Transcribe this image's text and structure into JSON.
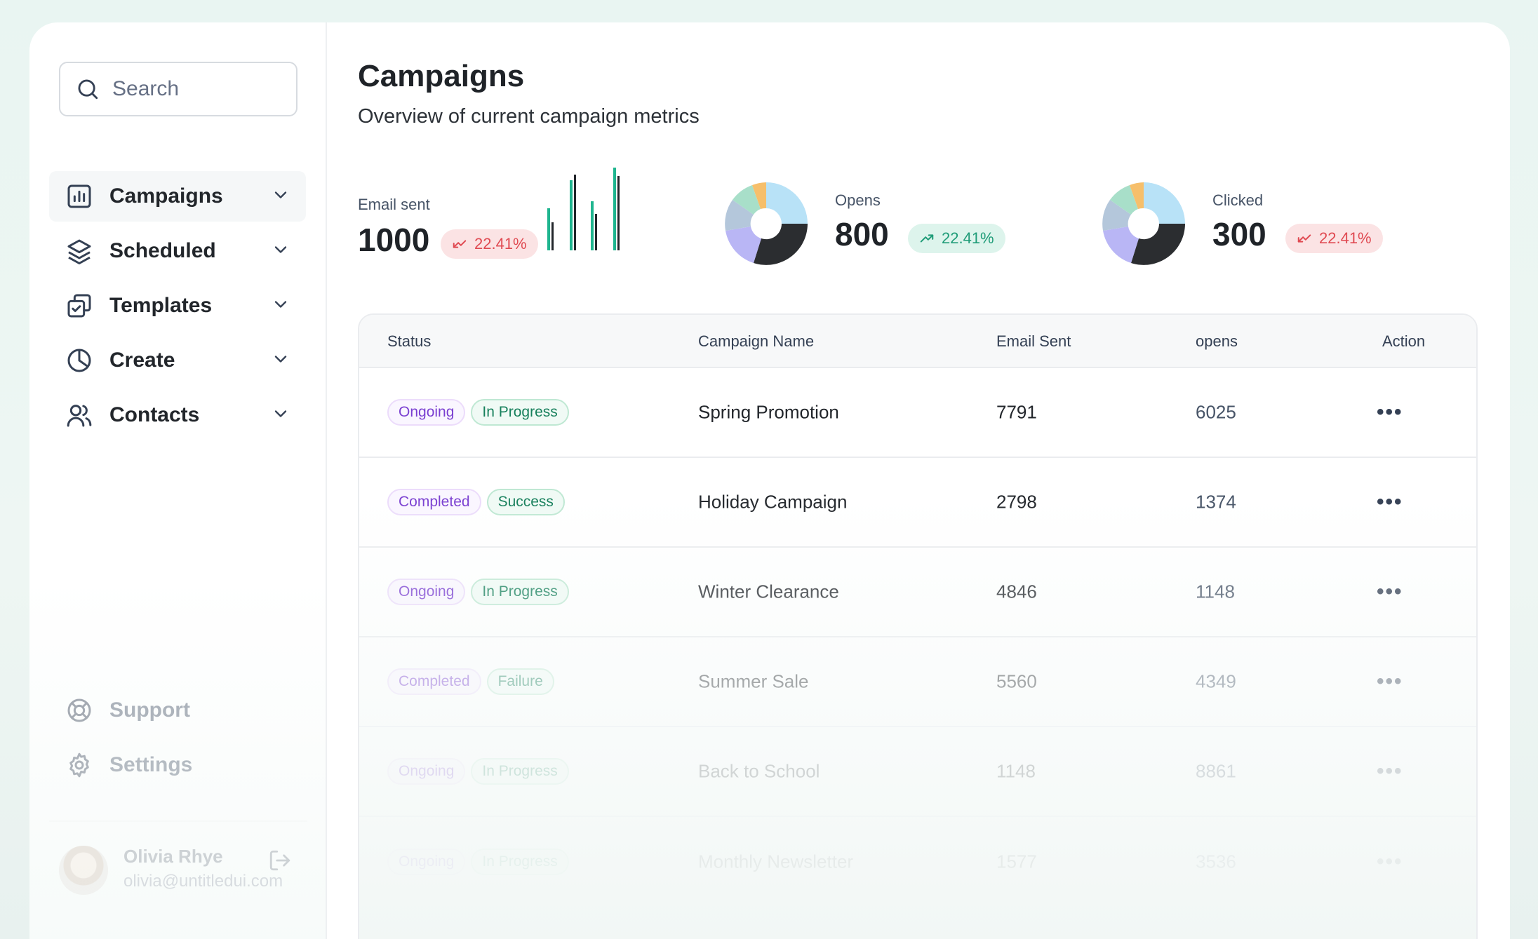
{
  "search": {
    "placeholder": "Search"
  },
  "sidebar": {
    "items": [
      {
        "label": "Campaigns",
        "icon": "bar-chart-icon",
        "active": true
      },
      {
        "label": "Scheduled",
        "icon": "layers-icon"
      },
      {
        "label": "Templates",
        "icon": "copy-check-icon"
      },
      {
        "label": "Create",
        "icon": "pie-chart-icon"
      },
      {
        "label": "Contacts",
        "icon": "users-icon"
      }
    ],
    "bottom": [
      {
        "label": "Support",
        "icon": "life-buoy-icon"
      },
      {
        "label": "Settings",
        "icon": "gear-icon"
      }
    ]
  },
  "user": {
    "name": "Olivia Rhye",
    "email": "olivia@untitledui.com"
  },
  "header": {
    "title": "Campaigns",
    "subtitle": "Overview of current campaign metrics"
  },
  "metrics": {
    "email_sent": {
      "label": "Email sent",
      "value": "1000",
      "change": "22.41%",
      "trend": "down"
    },
    "opens": {
      "label": "Opens",
      "value": "800",
      "change": "22.41%",
      "trend": "up"
    },
    "clicked": {
      "label": "Clicked",
      "value": "300",
      "change": "22.41%",
      "trend": "down"
    }
  },
  "colors": {
    "accent_teal": "#1fb58f",
    "down": "#e04a52",
    "up": "#1f9c78",
    "donut": [
      "#2b2d30",
      "#b9b6f5",
      "#b4c7db",
      "#a8dfc9",
      "#f6bf6b",
      "#b8e2f7"
    ]
  },
  "table": {
    "headers": [
      "Status",
      "Campaign Name",
      "Email Sent",
      "opens",
      "Action"
    ],
    "rows": [
      {
        "status": "Ongoing",
        "state": "In Progress",
        "name": "Spring Promotion",
        "sent": "7791",
        "opens": "6025"
      },
      {
        "status": "Completed",
        "state": "Success",
        "name": "Holiday Campaign",
        "sent": "2798",
        "opens": "1374"
      },
      {
        "status": "Ongoing",
        "state": "In Progress",
        "name": "Winter Clearance",
        "sent": "4846",
        "opens": "1148"
      },
      {
        "status": "Completed",
        "state": "Failure",
        "name": "Summer Sale",
        "sent": "5560",
        "opens": "4349"
      },
      {
        "status": "Ongoing",
        "state": "In Progress",
        "name": "Back to School",
        "sent": "1148",
        "opens": "8861"
      },
      {
        "status": "Ongoing",
        "state": "In Progress",
        "name": "Monthly Newsletter",
        "sent": "1577",
        "opens": "3536"
      }
    ],
    "action_label": "•••"
  }
}
